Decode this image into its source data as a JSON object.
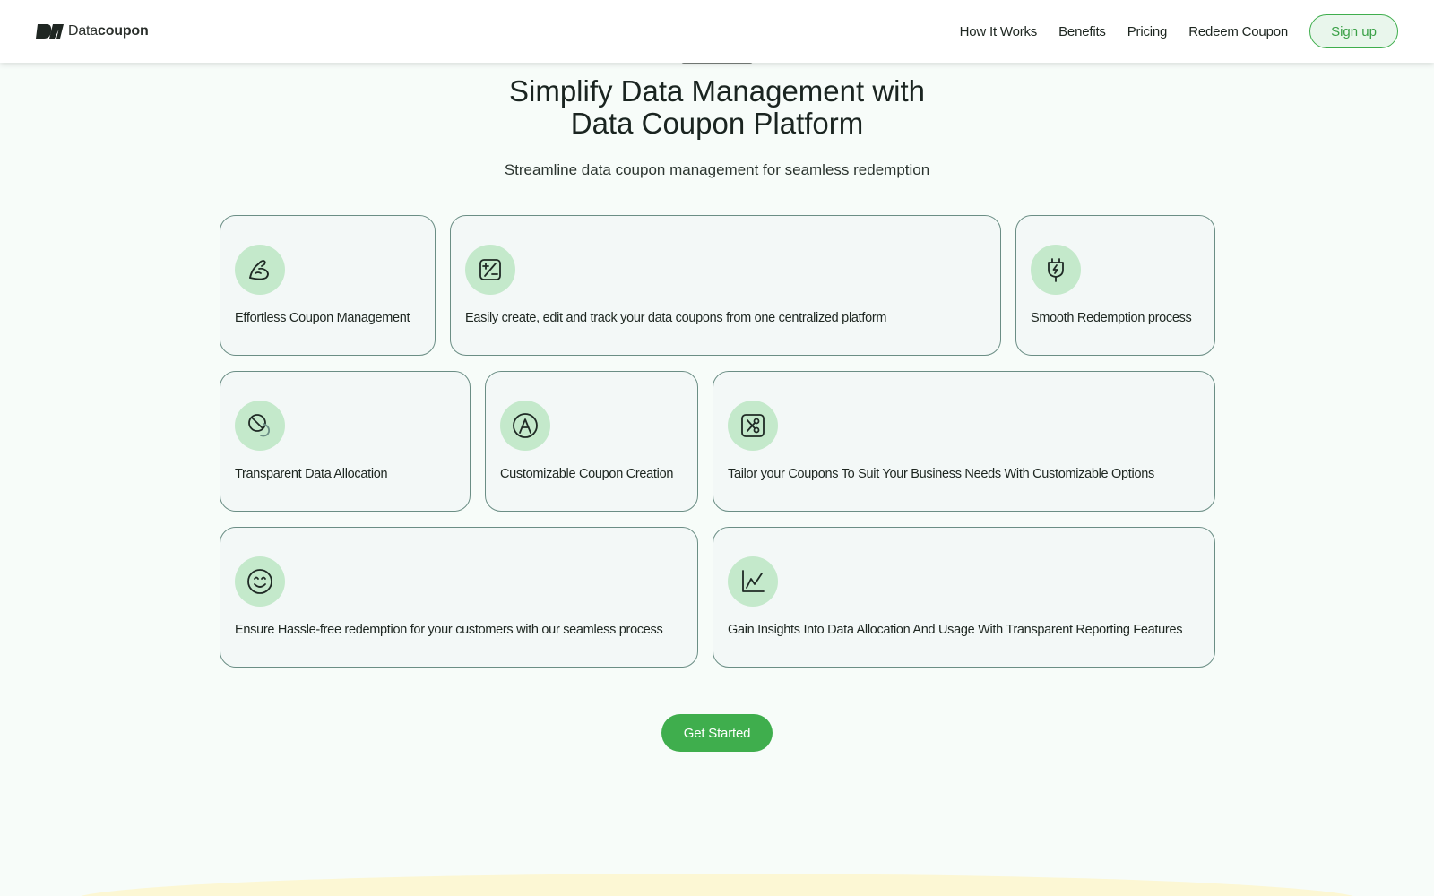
{
  "header": {
    "logo_prefix": "Data",
    "logo_suffix": "coupon",
    "nav": [
      "How It Works",
      "Benefits",
      "Pricing",
      "Redeem Coupon"
    ],
    "signup_label": "Sign up"
  },
  "hero": {
    "title_line1": "Simplify Data Management with",
    "title_line2": "Data Coupon Platform",
    "subtitle": "Streamline data coupon management for seamless redemption"
  },
  "cards": [
    {
      "text": "Effortless Coupon Management",
      "icon": "arm-icon"
    },
    {
      "text": "Easily create, edit and track your data coupons from one centralized platform",
      "icon": "percent-icon"
    },
    {
      "text": "Smooth Redemption process",
      "icon": "plug-icon"
    },
    {
      "text": "Transparent Data Allocation",
      "icon": "prohibited-icon"
    },
    {
      "text": "Customizable Coupon Creation",
      "icon": "letter-a-icon"
    },
    {
      "text": "Tailor your Coupons To Suit Your Business Needs With Customizable Options",
      "icon": "scissors-icon"
    },
    {
      "text": "Ensure Hassle-free redemption for your customers with our seamless process",
      "icon": "smile-icon"
    },
    {
      "text": "Gain Insights Into Data Allocation And Usage With Transparent Reporting Features",
      "icon": "chart-line-icon"
    }
  ],
  "cta": {
    "label": "Get Started"
  },
  "colors": {
    "accent": "#3fae4d",
    "icon_bg": "#c4e9cb",
    "card_border": "#6b8e85"
  }
}
